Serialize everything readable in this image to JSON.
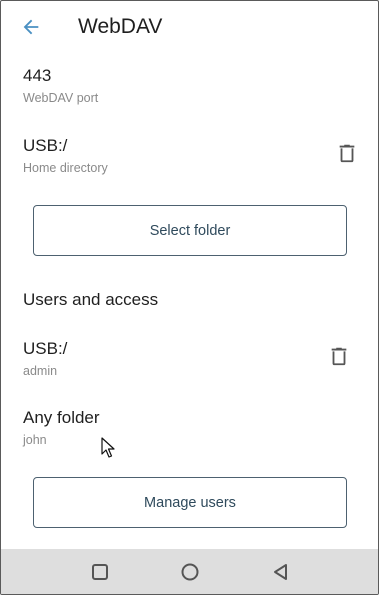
{
  "app_bar": {
    "title": "WebDAV",
    "back_icon": "arrow-back-icon"
  },
  "settings": {
    "port": {
      "value": "443",
      "label": "WebDAV port"
    },
    "home_directory": {
      "value": "USB:/",
      "label": "Home directory",
      "delete_icon": "trash-icon"
    },
    "select_folder_label": "Select folder"
  },
  "users_section": {
    "heading": "Users and access",
    "users": [
      {
        "folder": "USB:/",
        "user": "admin",
        "delete_icon": "trash-icon"
      },
      {
        "folder": "Any folder",
        "user": "john"
      }
    ],
    "manage_users_label": "Manage users"
  },
  "nav_bar": {
    "buttons": [
      "recents-square-icon",
      "home-circle-icon",
      "back-triangle-icon"
    ]
  },
  "colors": {
    "accent": "#4a90c2",
    "button_border": "#4d6170",
    "button_text": "#2f4a5c",
    "secondary_text": "#8a8a8a",
    "nav_bar_bg": "#dedede"
  }
}
